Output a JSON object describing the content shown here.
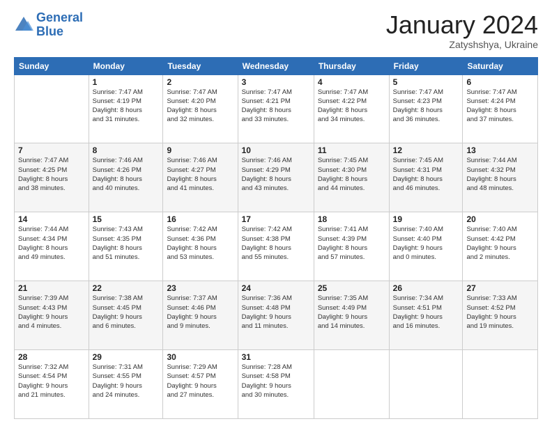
{
  "header": {
    "logo_line1": "General",
    "logo_line2": "Blue",
    "title": "January 2024",
    "subtitle": "Zatyshshya, Ukraine"
  },
  "columns": [
    "Sunday",
    "Monday",
    "Tuesday",
    "Wednesday",
    "Thursday",
    "Friday",
    "Saturday"
  ],
  "weeks": [
    [
      {
        "day": "",
        "info": ""
      },
      {
        "day": "1",
        "info": "Sunrise: 7:47 AM\nSunset: 4:19 PM\nDaylight: 8 hours\nand 31 minutes."
      },
      {
        "day": "2",
        "info": "Sunrise: 7:47 AM\nSunset: 4:20 PM\nDaylight: 8 hours\nand 32 minutes."
      },
      {
        "day": "3",
        "info": "Sunrise: 7:47 AM\nSunset: 4:21 PM\nDaylight: 8 hours\nand 33 minutes."
      },
      {
        "day": "4",
        "info": "Sunrise: 7:47 AM\nSunset: 4:22 PM\nDaylight: 8 hours\nand 34 minutes."
      },
      {
        "day": "5",
        "info": "Sunrise: 7:47 AM\nSunset: 4:23 PM\nDaylight: 8 hours\nand 36 minutes."
      },
      {
        "day": "6",
        "info": "Sunrise: 7:47 AM\nSunset: 4:24 PM\nDaylight: 8 hours\nand 37 minutes."
      }
    ],
    [
      {
        "day": "7",
        "info": "Sunrise: 7:47 AM\nSunset: 4:25 PM\nDaylight: 8 hours\nand 38 minutes."
      },
      {
        "day": "8",
        "info": "Sunrise: 7:46 AM\nSunset: 4:26 PM\nDaylight: 8 hours\nand 40 minutes."
      },
      {
        "day": "9",
        "info": "Sunrise: 7:46 AM\nSunset: 4:27 PM\nDaylight: 8 hours\nand 41 minutes."
      },
      {
        "day": "10",
        "info": "Sunrise: 7:46 AM\nSunset: 4:29 PM\nDaylight: 8 hours\nand 43 minutes."
      },
      {
        "day": "11",
        "info": "Sunrise: 7:45 AM\nSunset: 4:30 PM\nDaylight: 8 hours\nand 44 minutes."
      },
      {
        "day": "12",
        "info": "Sunrise: 7:45 AM\nSunset: 4:31 PM\nDaylight: 8 hours\nand 46 minutes."
      },
      {
        "day": "13",
        "info": "Sunrise: 7:44 AM\nSunset: 4:32 PM\nDaylight: 8 hours\nand 48 minutes."
      }
    ],
    [
      {
        "day": "14",
        "info": "Sunrise: 7:44 AM\nSunset: 4:34 PM\nDaylight: 8 hours\nand 49 minutes."
      },
      {
        "day": "15",
        "info": "Sunrise: 7:43 AM\nSunset: 4:35 PM\nDaylight: 8 hours\nand 51 minutes."
      },
      {
        "day": "16",
        "info": "Sunrise: 7:42 AM\nSunset: 4:36 PM\nDaylight: 8 hours\nand 53 minutes."
      },
      {
        "day": "17",
        "info": "Sunrise: 7:42 AM\nSunset: 4:38 PM\nDaylight: 8 hours\nand 55 minutes."
      },
      {
        "day": "18",
        "info": "Sunrise: 7:41 AM\nSunset: 4:39 PM\nDaylight: 8 hours\nand 57 minutes."
      },
      {
        "day": "19",
        "info": "Sunrise: 7:40 AM\nSunset: 4:40 PM\nDaylight: 9 hours\nand 0 minutes."
      },
      {
        "day": "20",
        "info": "Sunrise: 7:40 AM\nSunset: 4:42 PM\nDaylight: 9 hours\nand 2 minutes."
      }
    ],
    [
      {
        "day": "21",
        "info": "Sunrise: 7:39 AM\nSunset: 4:43 PM\nDaylight: 9 hours\nand 4 minutes."
      },
      {
        "day": "22",
        "info": "Sunrise: 7:38 AM\nSunset: 4:45 PM\nDaylight: 9 hours\nand 6 minutes."
      },
      {
        "day": "23",
        "info": "Sunrise: 7:37 AM\nSunset: 4:46 PM\nDaylight: 9 hours\nand 9 minutes."
      },
      {
        "day": "24",
        "info": "Sunrise: 7:36 AM\nSunset: 4:48 PM\nDaylight: 9 hours\nand 11 minutes."
      },
      {
        "day": "25",
        "info": "Sunrise: 7:35 AM\nSunset: 4:49 PM\nDaylight: 9 hours\nand 14 minutes."
      },
      {
        "day": "26",
        "info": "Sunrise: 7:34 AM\nSunset: 4:51 PM\nDaylight: 9 hours\nand 16 minutes."
      },
      {
        "day": "27",
        "info": "Sunrise: 7:33 AM\nSunset: 4:52 PM\nDaylight: 9 hours\nand 19 minutes."
      }
    ],
    [
      {
        "day": "28",
        "info": "Sunrise: 7:32 AM\nSunset: 4:54 PM\nDaylight: 9 hours\nand 21 minutes."
      },
      {
        "day": "29",
        "info": "Sunrise: 7:31 AM\nSunset: 4:55 PM\nDaylight: 9 hours\nand 24 minutes."
      },
      {
        "day": "30",
        "info": "Sunrise: 7:29 AM\nSunset: 4:57 PM\nDaylight: 9 hours\nand 27 minutes."
      },
      {
        "day": "31",
        "info": "Sunrise: 7:28 AM\nSunset: 4:58 PM\nDaylight: 9 hours\nand 30 minutes."
      },
      {
        "day": "",
        "info": ""
      },
      {
        "day": "",
        "info": ""
      },
      {
        "day": "",
        "info": ""
      }
    ]
  ]
}
